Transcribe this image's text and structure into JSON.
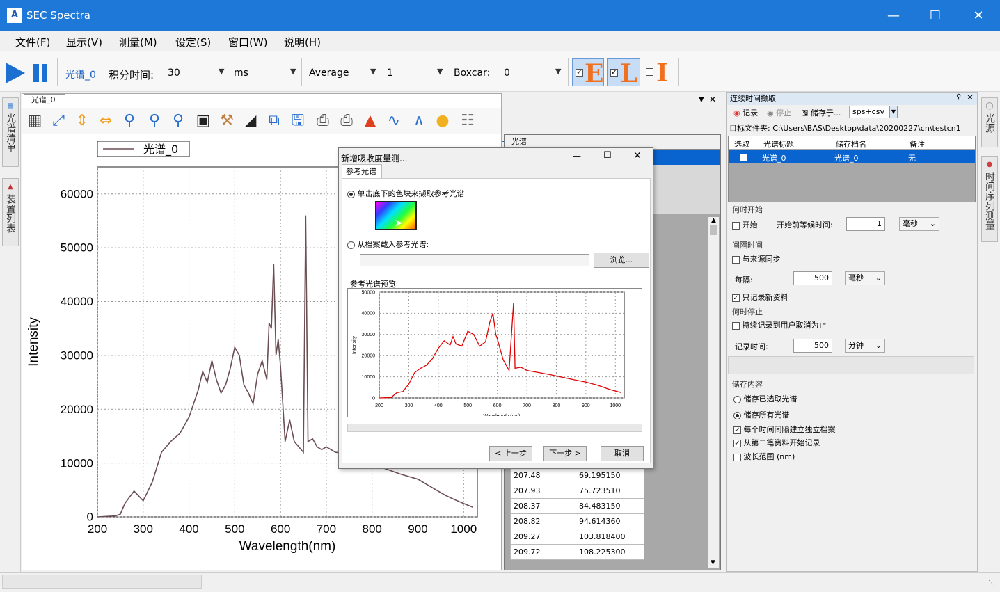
{
  "app": {
    "title": "SEC Spectra"
  },
  "menu": [
    "文件(F)",
    "显示(V)",
    "测量(M)",
    "设定(S)",
    "窗口(W)",
    "说明(H)"
  ],
  "toolbar": {
    "spectrum_label": "光谱_0",
    "integration_label": "积分时间:",
    "integration_value": "30",
    "unit_value": "ms",
    "mode_value": "Average",
    "average_count": "1",
    "boxcar_label": "Boxcar:",
    "boxcar_value": "0",
    "e_btn": "E",
    "l_btn": "L",
    "i_btn": "I"
  },
  "left_tabs": [
    "光谱清单",
    "装置列表"
  ],
  "plot": {
    "tab_label": "光谱_0",
    "legend": "光谱_0"
  },
  "chart_data": [
    {
      "type": "line",
      "title": "",
      "xlabel": "Wavelength(nm)",
      "ylabel": "Intensity",
      "xlim": [
        200,
        1030
      ],
      "ylim": [
        0,
        65000
      ],
      "xticks": [
        "200",
        "300",
        "400",
        "500",
        "600",
        "700",
        "800",
        "900",
        "1000"
      ],
      "yticks": [
        "0",
        "10000",
        "20000",
        "30000",
        "40000",
        "50000",
        "60000"
      ],
      "grid": true,
      "legend_position": "top-left",
      "series": [
        {
          "name": "光谱_0",
          "color": "#6b4e53",
          "x": [
            200,
            240,
            250,
            260,
            280,
            300,
            320,
            340,
            360,
            380,
            400,
            420,
            430,
            440,
            450,
            460,
            470,
            480,
            490,
            500,
            510,
            520,
            530,
            540,
            550,
            560,
            570,
            575,
            580,
            585,
            590,
            595,
            600,
            610,
            620,
            630,
            640,
            650,
            655,
            660,
            670,
            680,
            690,
            700,
            720,
            740,
            760,
            780,
            800,
            820,
            840,
            860,
            880,
            900,
            920,
            940,
            960,
            980,
            1000,
            1020
          ],
          "y": [
            0,
            200,
            500,
            2500,
            4800,
            3000,
            6500,
            12000,
            14000,
            15500,
            18500,
            23500,
            27000,
            25000,
            29000,
            25500,
            23000,
            24500,
            27500,
            31500,
            30000,
            24500,
            23000,
            21000,
            26500,
            29000,
            25500,
            36000,
            35000,
            47000,
            30000,
            33000,
            28000,
            14000,
            18000,
            14000,
            13000,
            12000,
            56000,
            14000,
            14500,
            13000,
            12500,
            13000,
            12000,
            11800,
            11000,
            10500,
            9800,
            9200,
            8600,
            8000,
            7500,
            7000,
            6000,
            5000,
            4000,
            3200,
            2500,
            1800
          ]
        }
      ]
    },
    {
      "type": "line",
      "title": "",
      "xlabel": "Wavelength (nm)",
      "ylabel": "Intensity",
      "xlim": [
        200,
        1030
      ],
      "ylim": [
        0,
        50000
      ],
      "xticks": [
        "200",
        "300",
        "400",
        "500",
        "600",
        "700",
        "800",
        "900",
        "1000"
      ],
      "yticks": [
        "0",
        "10000",
        "20000",
        "30000",
        "40000",
        "50000"
      ],
      "grid": true,
      "series": [
        {
          "color": "#e00000",
          "x": [
            200,
            240,
            260,
            280,
            300,
            320,
            340,
            360,
            380,
            400,
            420,
            440,
            450,
            460,
            480,
            500,
            520,
            540,
            560,
            575,
            585,
            595,
            600,
            620,
            640,
            655,
            660,
            680,
            700,
            740,
            780,
            820,
            860,
            900,
            940,
            980,
            1020
          ],
          "y": [
            0,
            200,
            2500,
            3000,
            6500,
            12000,
            14000,
            15500,
            18500,
            23500,
            27000,
            25000,
            29000,
            25500,
            24500,
            31500,
            30000,
            24500,
            26500,
            36000,
            40000,
            30000,
            28000,
            18000,
            13000,
            45000,
            14000,
            14500,
            13000,
            12000,
            11000,
            9800,
            8600,
            7500,
            6000,
            4000,
            2500
          ]
        }
      ]
    }
  ],
  "data_panel": {
    "header": "光谱",
    "rows": [
      [
        "207.48",
        "69.195150"
      ],
      [
        "207.93",
        "75.723510"
      ],
      [
        "208.37",
        "84.483150"
      ],
      [
        "208.82",
        "94.614360"
      ],
      [
        "209.27",
        "103.818400"
      ],
      [
        "209.72",
        "108.225300"
      ]
    ]
  },
  "dialog": {
    "title": "新增吸收度量测...",
    "tab": "参考光谱",
    "option1": "单击底下的色块来撷取参考光谱",
    "option2": "从档案载入参考光谱:",
    "browse": "浏览...",
    "preview_title": "参考光谱预览",
    "prev": "< 上一步",
    "next": "下一步 >",
    "cancel": "取消"
  },
  "side": {
    "title": "连续时间撷取",
    "record": "记录",
    "stop": "停止",
    "save_to": "储存于...",
    "format": "sps+csv",
    "target_folder": "目标文件夹: C:\\Users\\BAS\\Desktop\\data\\20200227\\cn\\testcn1",
    "table_headers": [
      "选取",
      "光谱标题",
      "储存档名",
      "备注"
    ],
    "table_row": [
      "",
      "光谱_0",
      "光谱_0",
      "无"
    ],
    "when_start": "何时开始",
    "start": "开始",
    "wait_label": "开始前等候时间:",
    "wait_value": "1",
    "wait_unit": "毫秒",
    "interval": "间隔时间",
    "sync": "与来源同步",
    "every": "每隔:",
    "every_value": "500",
    "every_unit": "毫秒",
    "only_new": "只记录新资料",
    "when_stop": "何时停止",
    "until_cancel": "持续记录到用户取消为止",
    "record_time": "记录时间:",
    "record_value": "500",
    "record_unit": "分钟",
    "store_content": "储存内容",
    "store_selected": "储存已选取光谱",
    "store_all": "储存所有光谱",
    "each_file": "每个时间间隔建立独立档案",
    "from_second": "从第二笔资料开始记录",
    "wl_range": "波长范围 (nm)"
  },
  "right_tabs": [
    "光源",
    "时间序列测量"
  ]
}
